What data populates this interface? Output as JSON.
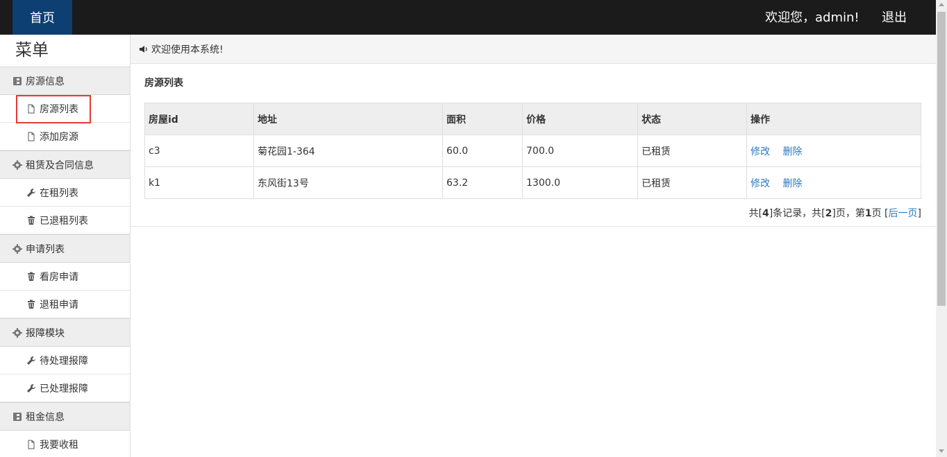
{
  "header": {
    "home_label": "首页",
    "welcome_text": "欢迎您，admin!",
    "logout_label": "退出"
  },
  "sidebar": {
    "title": "菜单",
    "groups": [
      {
        "label": "房源信息",
        "icon": "card-icon",
        "items": [
          {
            "label": "房源列表",
            "icon": "file-icon"
          },
          {
            "label": "添加房源",
            "icon": "file-icon"
          }
        ]
      },
      {
        "label": "租赁及合同信息",
        "icon": "gear-icon",
        "items": [
          {
            "label": "在租列表",
            "icon": "wrench-icon"
          },
          {
            "label": "已退租列表",
            "icon": "trash-icon"
          }
        ]
      },
      {
        "label": "申请列表",
        "icon": "gear-icon",
        "items": [
          {
            "label": "看房申请",
            "icon": "trash-icon"
          },
          {
            "label": "退租申请",
            "icon": "trash-icon"
          }
        ]
      },
      {
        "label": "报障模块",
        "icon": "gear-icon",
        "items": [
          {
            "label": "待处理报障",
            "icon": "wrench-icon"
          },
          {
            "label": "已处理报障",
            "icon": "wrench-icon"
          }
        ]
      },
      {
        "label": "租金信息",
        "icon": "card-icon",
        "items": [
          {
            "label": "我要收租",
            "icon": "file-icon"
          }
        ]
      }
    ]
  },
  "main": {
    "notice": "欢迎使用本系统!",
    "list_title": "房源列表",
    "table": {
      "headers": [
        "房屋id",
        "地址",
        "面积",
        "价格",
        "状态",
        "操作"
      ],
      "rows": [
        {
          "id": "c3",
          "address": "菊花园1-364",
          "area": "60.0",
          "price": "700.0",
          "status": "已租赁",
          "edit": "修改",
          "delete": "删除"
        },
        {
          "id": "k1",
          "address": "东风街13号",
          "area": "63.2",
          "price": "1300.0",
          "status": "已租赁",
          "edit": "修改",
          "delete": "删除"
        }
      ]
    },
    "pager": {
      "prefix": "共[",
      "total": "4",
      "mid1": "]条记录，共[",
      "pages": "2",
      "mid2": "]页，第",
      "current": "1",
      "mid3": "页 [",
      "next": "后一页",
      "suffix": "]"
    }
  }
}
